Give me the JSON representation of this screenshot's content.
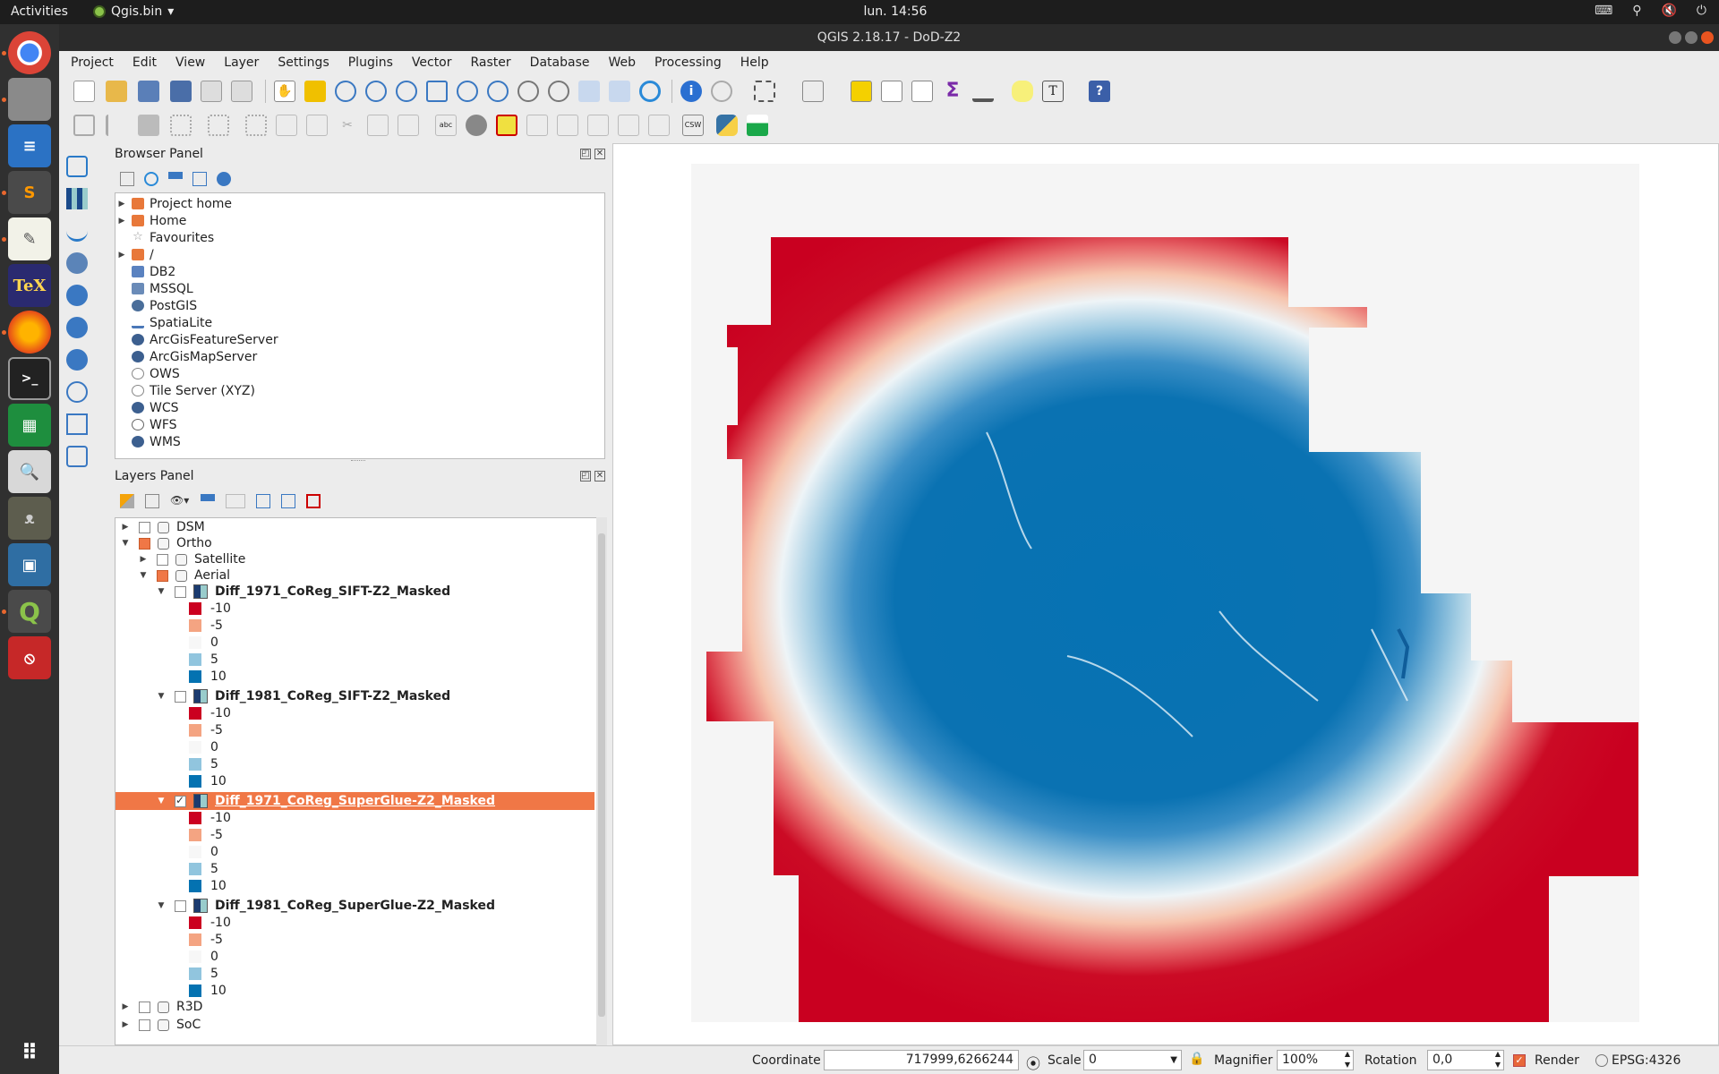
{
  "topbar": {
    "activities": "Activities",
    "app_name": "Qgis.bin",
    "clock": "lun. 14:56"
  },
  "window": {
    "title": "QGIS 2.18.17 - DoD-Z2"
  },
  "menu": [
    "Project",
    "Edit",
    "View",
    "Layer",
    "Settings",
    "Plugins",
    "Vector",
    "Raster",
    "Database",
    "Web",
    "Processing",
    "Help"
  ],
  "browser_panel": {
    "title": "Browser Panel",
    "items": [
      {
        "label": "Project home",
        "icon": "folder-icon",
        "expandable": true
      },
      {
        "label": "Home",
        "icon": "folder-icon",
        "expandable": true
      },
      {
        "label": "Favourites",
        "icon": "star-icon",
        "expandable": false
      },
      {
        "label": "/",
        "icon": "folder-icon",
        "expandable": true
      },
      {
        "label": "DB2",
        "icon": "db2-icon",
        "expandable": false
      },
      {
        "label": "MSSQL",
        "icon": "mssql-icon",
        "expandable": false
      },
      {
        "label": "PostGIS",
        "icon": "postgis-icon",
        "expandable": false
      },
      {
        "label": "SpatiaLite",
        "icon": "spatialite-icon",
        "expandable": false
      },
      {
        "label": "ArcGisFeatureServer",
        "icon": "globe-icon",
        "expandable": false
      },
      {
        "label": "ArcGisMapServer",
        "icon": "globe-icon",
        "expandable": false
      },
      {
        "label": "OWS",
        "icon": "globe-icon",
        "expandable": false
      },
      {
        "label": "Tile Server (XYZ)",
        "icon": "globe-icon",
        "expandable": false
      },
      {
        "label": "WCS",
        "icon": "globe-icon",
        "expandable": false
      },
      {
        "label": "WFS",
        "icon": "globe-icon",
        "expandable": false
      },
      {
        "label": "WMS",
        "icon": "globe-icon",
        "expandable": false
      }
    ]
  },
  "layers_panel": {
    "title": "Layers Panel",
    "legend": [
      "-10",
      "-5",
      "0",
      "5",
      "10"
    ],
    "legend_colors": [
      "#cb0020",
      "#f4a482",
      "#f7f7f7",
      "#91c5de",
      "#0472b1"
    ],
    "groups": {
      "dsm": "DSM",
      "ortho": "Ortho",
      "satellite": "Satellite",
      "aerial": "Aerial",
      "r3d": "R3D",
      "soc": "SoC"
    },
    "rasters": [
      {
        "name": "Diff_1971_CoReg_SIFT-Z2_Masked",
        "checked": false,
        "selected": false
      },
      {
        "name": "Diff_1981_CoReg_SIFT-Z2_Masked",
        "checked": false,
        "selected": false
      },
      {
        "name": "Diff_1971_CoReg_SuperGlue-Z2_Masked",
        "checked": true,
        "selected": true
      },
      {
        "name": "Diff_1981_CoReg_SuperGlue-Z2_Masked",
        "checked": false,
        "selected": false
      }
    ]
  },
  "status": {
    "coordinate_label": "Coordinate",
    "coordinate_value": "717999,6266244",
    "scale_label": "Scale",
    "scale_value": "0",
    "magnifier_label": "Magnifier",
    "magnifier_value": "100%",
    "rotation_label": "Rotation",
    "rotation_value": "0,0",
    "render_label": "Render",
    "render_checked": true,
    "crs": "EPSG:4326"
  }
}
